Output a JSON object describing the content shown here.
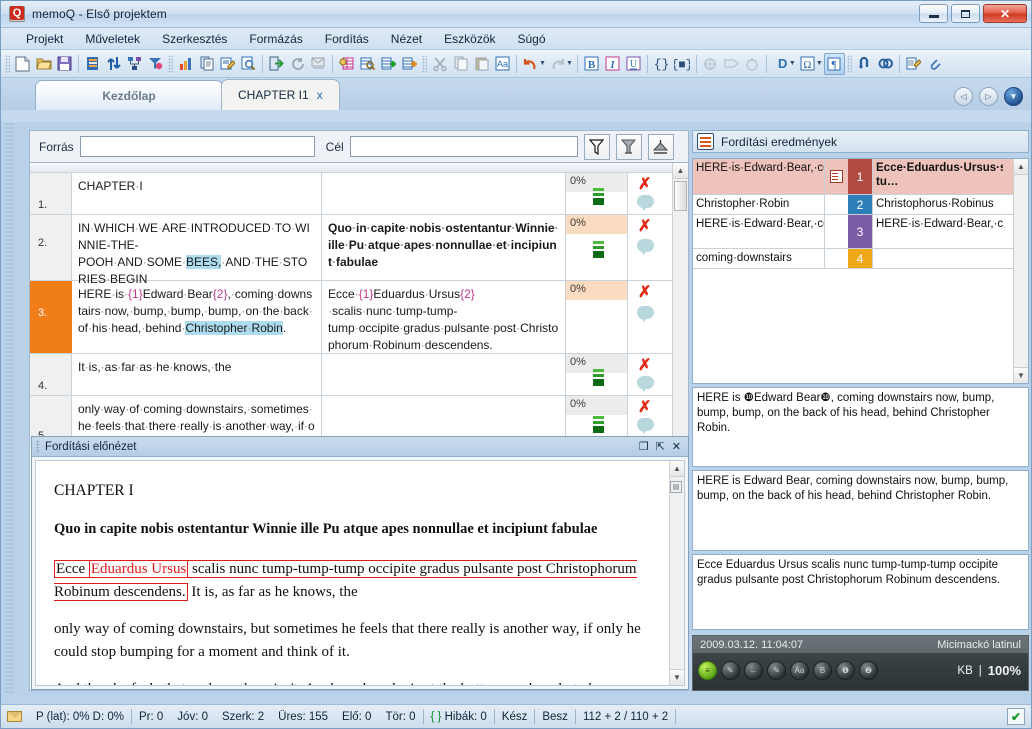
{
  "window": {
    "title": "memoQ - Első projektem",
    "app_icon": "memoq-logo-icon",
    "minimize_label": "Minimize",
    "maximize_label": "Maximize",
    "close_label": "Close"
  },
  "menu": [
    {
      "label": "Projekt",
      "accel": "k"
    },
    {
      "label": "Műveletek",
      "accel": "M"
    },
    {
      "label": "Szerkesztés",
      "accel": "z"
    },
    {
      "label": "Formázás",
      "accel": "F"
    },
    {
      "label": "Fordítás",
      "accel": "F"
    },
    {
      "label": "Nézet",
      "accel": "N"
    },
    {
      "label": "Eszközök",
      "accel": "E"
    },
    {
      "label": "Súgó",
      "accel": "S"
    }
  ],
  "toolbar": {
    "groups": [
      [
        "new-document-icon",
        "open-folder-icon",
        "save-icon"
      ],
      [
        "project-book-icon",
        "sync-arrows-icon",
        "network-tree-icon",
        "import-funnel-icon"
      ],
      [
        "statistics-chart-icon",
        "copy-document-icon",
        "edit-document-icon",
        "preview-document-icon"
      ],
      [
        "export-arrow-icon",
        "refresh-circle-icon",
        "mail-send-icon"
      ],
      [
        "translation-memory-icon",
        "concordance-search-icon",
        "add-tm-icon",
        "add-termbase-icon"
      ],
      [
        "cut-scissors-icon",
        "copy-icon",
        "paste-icon",
        "format-aa-icon"
      ],
      [
        "undo-icon",
        "undo-dropdown-caret",
        "redo-icon",
        "redo-dropdown-caret"
      ],
      [
        "bold-icon",
        "italic-icon",
        "underline-icon"
      ],
      [
        "curly-tag-icon",
        "inline-tag-icon"
      ],
      [
        "spellcheck-icon",
        "tag-insert-icon",
        "qa-check-icon"
      ],
      [
        "dropcap-d-icon",
        "d-dropdown-caret",
        "omega-symbol-icon",
        "omega-dropdown-caret",
        "formatting-marks-icon"
      ],
      [
        "confirm-loop-icon",
        "lookup-icon"
      ],
      [
        "notes-icon",
        "attach-icon"
      ]
    ]
  },
  "tabs": {
    "home_label": "Kezdőlap",
    "document_label": "CHAPTER I1",
    "close_glyph": "x",
    "nav_prev": "◁",
    "nav_next": "▷",
    "nav_menu": "▼"
  },
  "filter_bar": {
    "source_label": "Forrás",
    "source_value": "",
    "source_placeholder": "",
    "target_label": "Cél",
    "target_value": "",
    "target_placeholder": "",
    "buttons": [
      "filter-funnel-icon",
      "clear-filter-icon",
      "sort-filter-icon"
    ]
  },
  "grid": {
    "rows": [
      {
        "num": "1.",
        "source_parts": [
          {
            "t": "CHAPTER",
            "k": "plain"
          },
          {
            "t": "·",
            "k": "dot"
          },
          {
            "t": "I",
            "k": "plain"
          }
        ],
        "target_parts": [],
        "target_bold": false,
        "match": "0%",
        "match_warn": false,
        "active": false,
        "has_bars": true,
        "has_x": true,
        "has_bubble": true
      },
      {
        "num": "2.",
        "source_parts": [
          {
            "t": "IN·WHICH·WE·ARE·INTRODUCED·TO·WINNIE-THE-POOH·AND·SOME·",
            "k": "plain"
          },
          {
            "t": "BEES,",
            "k": "hl"
          },
          {
            "t": "·AND·THE·STORIES·BEGIN",
            "k": "plain"
          }
        ],
        "target_parts": [
          {
            "t": "Quo·in·capite·nobis·ostentantur·Winnie·ille·Pu·atque·apes·nonnullae·et·incipiunt·fabulae",
            "k": "plain"
          }
        ],
        "target_bold": true,
        "match": "0%",
        "match_warn": true,
        "active": false,
        "has_bars": true,
        "has_x": true,
        "has_bubble": true
      },
      {
        "num": "3.",
        "source_parts": [
          {
            "t": "HERE·is·",
            "k": "plain"
          },
          {
            "t": "{1}",
            "k": "tag"
          },
          {
            "t": "Edward·Bear",
            "k": "plain"
          },
          {
            "t": "{2}",
            "k": "tag"
          },
          {
            "t": ",·coming·downstairs·now,·bump,·bump,·bump,·on·the·back·of·his·head,·behind·",
            "k": "plain"
          },
          {
            "t": "Christopher·Robin",
            "k": "hl"
          },
          {
            "t": ".",
            "k": "plain"
          }
        ],
        "target_parts": [
          {
            "t": "Ecce·",
            "k": "plain"
          },
          {
            "t": "{1}",
            "k": "tag"
          },
          {
            "t": "Eduardus·Ursus",
            "k": "plain"
          },
          {
            "t": "{2}",
            "k": "tag"
          },
          {
            "t": "·scalis·nunc·tump-tump-tump·occipite·gradus·pulsante·post·Christophorum·Robinum·descendens.",
            "k": "plain"
          }
        ],
        "target_bold": false,
        "match": "0%",
        "match_warn": true,
        "active": true,
        "has_bars": false,
        "has_x": true,
        "has_bubble": true
      },
      {
        "num": "4.",
        "source_parts": [
          {
            "t": "It·is,·as·far·as·he·knows,·the",
            "k": "plain"
          }
        ],
        "target_parts": [],
        "target_bold": false,
        "match": "0%",
        "match_warn": false,
        "active": false,
        "has_bars": true,
        "has_x": true,
        "has_bubble": true
      },
      {
        "num": "5.",
        "source_parts": [
          {
            "t": "only·way·of·coming·downstairs,·but·sometimes·he·feels·that·there·really·is·another·way,·if·only·he·could·stop·",
            "k": "plain"
          }
        ],
        "target_parts": [],
        "target_bold": false,
        "match": "0%",
        "match_warn": false,
        "active": false,
        "has_bars": true,
        "has_x": true,
        "has_bubble": true
      }
    ]
  },
  "preview": {
    "title": "Fordítási előnézet",
    "btn_float": "❐",
    "btn_pin": "⇱",
    "btn_close": "✕",
    "heading1": "CHAPTER I",
    "heading2": "Quo in capite nobis ostentantur Winnie ille Pu atque apes nonnullae et incipiunt fabulae",
    "para1_a": "Ecce ",
    "para1_b": "Eduardus Ursus",
    "para1_c": " scalis nunc tump-tump-tump occipite gradus pulsante post Christophorum Robinum descendens.",
    "para1_d": " It is, as far as he knows, the",
    "para2": "only way of coming downstairs, but sometimes he feels that there really is another way, if only he could stop bumping for a moment and think of it.",
    "para3": "And then he feels that perhaps there isn't. Anyhow, here he is at the bottom, and ready to be introduced to you. Winnie-the-Pooh."
  },
  "results_panel": {
    "title": "Fordítási eredmények",
    "rows": [
      {
        "source": "HERE·is·Edward·Bear,·coming·downstairs·…",
        "target": "Ecce·Eduardus·Ursus·scalis·nunc·tump-tu…",
        "rank": "1",
        "rank_color": "#b04b41",
        "highlight": true,
        "has_icon": true,
        "icon": "tm-edit-icon"
      },
      {
        "source": "Christopher·Robin",
        "target": "Christophorus·Robinus",
        "rank": "2",
        "rank_color": "#2d7fb8",
        "highlight": false,
        "has_icon": false,
        "icon": ""
      },
      {
        "source": "HERE·is·Edward·Bear,·coming·downstairs·…",
        "target": "HERE·is·Edward·Bear,·coming·downstairs·…",
        "rank": "3",
        "rank_color": "#7b5aa6",
        "highlight": false,
        "has_icon": false,
        "icon": ""
      },
      {
        "source": "coming·downstairs",
        "target": "",
        "rank": "4",
        "rank_color": "#f0a818",
        "highlight": false,
        "has_icon": false,
        "icon": ""
      }
    ],
    "box_source": "HERE is ❿Edward Bear❿, coming downstairs now, bump, bump, bump, on the back of his head, behind Christopher Robin.",
    "box_compare": "HERE is Edward Bear, coming downstairs now, bump, bump, bump, on the back of his head, behind Christopher Robin.",
    "box_target": "Ecce Eduardus Ursus scalis nunc tump-tump-tump occipite gradus pulsante post Christophorum Robinum descendens.",
    "meta_timestamp": "2009.03.12. 11:04:07",
    "meta_name": "Micimackó latinul",
    "meta_unit": "KB",
    "meta_divider": "|",
    "meta_percent": "100%",
    "orbs": [
      "status-green-icon",
      "pencil-icon",
      "arrow-left-icon",
      "pencil-alt-icon",
      "font-aa-icon",
      "bold-b-icon",
      "tag1-icon",
      "tag2-icon"
    ]
  },
  "statusbar": {
    "mail_icon": "mail-icon",
    "cells": [
      "P (lat): 0%  D: 0%",
      "Pr: 0",
      "Jóv: 0",
      "Szerk: 2",
      "Üres: 155",
      "Elő: 0",
      "Tör: 0"
    ],
    "errors_brace": "{ }",
    "errors_label": "Hibák: 0",
    "ready_label": "Kész",
    "besz_label": "Besz",
    "counter": "112 + 2 / 110 + 2",
    "ok_glyph": "✔"
  },
  "colors": {
    "accent_orange": "#f07d18",
    "error_red": "#e22a17",
    "match_warn": "#fbdcc0",
    "highlight_blue": "#aedcef",
    "tag_magenta": "#c0398f",
    "green_ok": "#1a9c2a"
  }
}
